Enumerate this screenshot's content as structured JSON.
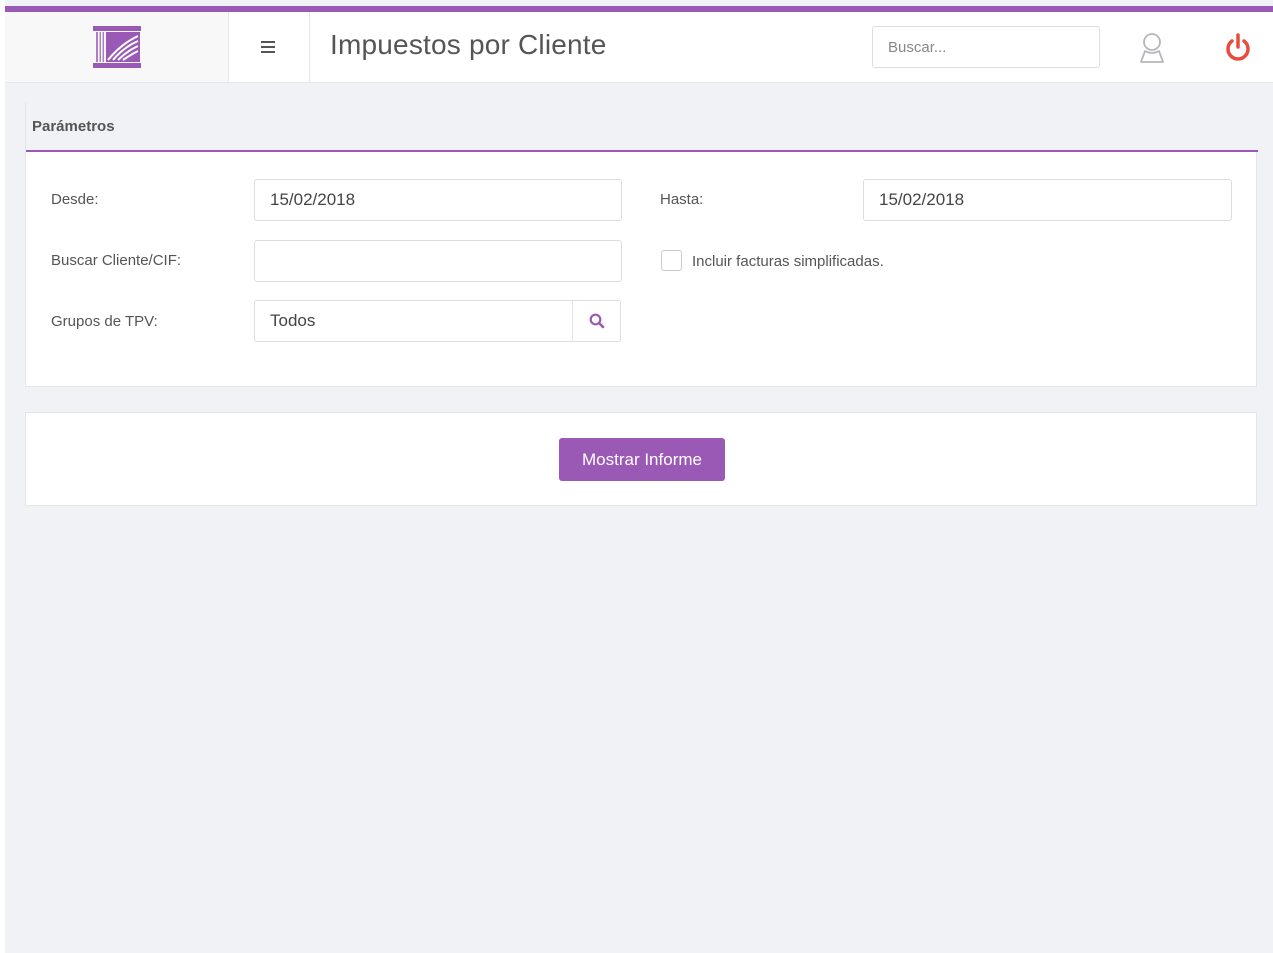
{
  "header": {
    "title": "Impuestos por Cliente",
    "search_placeholder": "Buscar..."
  },
  "colors": {
    "accent": "#9b59b6",
    "power": "#e74c3c"
  },
  "icons": {
    "logo": "columns-building-logo",
    "menu": "hamburger-icon",
    "user": "user-icon",
    "power": "power-icon",
    "search": "search-icon"
  },
  "params": {
    "heading": "Parámetros",
    "desde_label": "Desde:",
    "desde_value": "15/02/2018",
    "hasta_label": "Hasta:",
    "hasta_value": "15/02/2018",
    "cliente_label": "Buscar Cliente/CIF:",
    "cliente_value": "",
    "simplificadas_label": "Incluir facturas simplificadas.",
    "simplificadas_checked": false,
    "grupos_label": "Grupos de TPV:",
    "grupos_value": "Todos"
  },
  "actions": {
    "show_report": "Mostrar Informe"
  }
}
